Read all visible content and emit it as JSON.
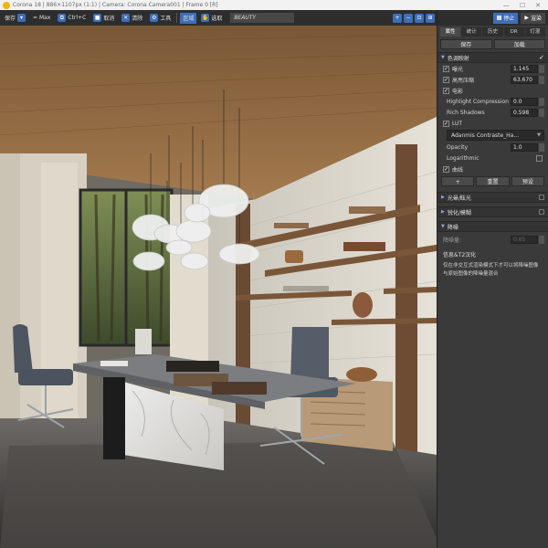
{
  "titlebar": {
    "title": "Corona 18 | 886×1107px (1:1) | Camera: Corona Camera001 | Frame 0 [R]",
    "controls": [
      "—",
      "☐",
      "✕"
    ]
  },
  "toolbar": {
    "save": "保存",
    "max": "= Max",
    "copy": "Ctrl+C",
    "stop_render": "取消",
    "clear": "清除",
    "tools": "工具",
    "region": "区域",
    "select": "选取",
    "pass": "BEAUTY"
  },
  "panel": {
    "stop": "停止",
    "render": "渲染",
    "tabs": [
      "属性",
      "统计",
      "历史",
      "DR",
      "灯混"
    ],
    "save": "保存",
    "load": "加载",
    "tonemapping": {
      "label": "色调映射",
      "exposure_label": "曝光",
      "exposure_value": "1.145",
      "highlight_label": "高亮压缩",
      "highlight_value": "63.670",
      "filmic_label": "电影",
      "highlight_compression_label": "Highlight Compression",
      "highlight_compression_value": "0.0",
      "rich_shadows_label": "Rich Shadows",
      "rich_shadows_value": "0.598",
      "lut_label": "LUT",
      "lut_value": "Adanmis Contraste_Ha...",
      "opacity_label": "Opacity",
      "opacity_value": "1.0",
      "log_label": "Logarithmic",
      "curves_label": "曲线",
      "curve_add": "+",
      "curve_reset": "重置",
      "curve_preset": "预设"
    },
    "bloom": "光晕/眩光",
    "sharpen": "锐化/模糊",
    "denoise": {
      "label": "降噪",
      "amount_label": "降噪量:",
      "amount_value": "0.65"
    },
    "note_title": "信息&T2汉化",
    "note_text": "仅在非交互式渲染模式下才可以将降噪图像与原始图像的降噪量混合"
  }
}
